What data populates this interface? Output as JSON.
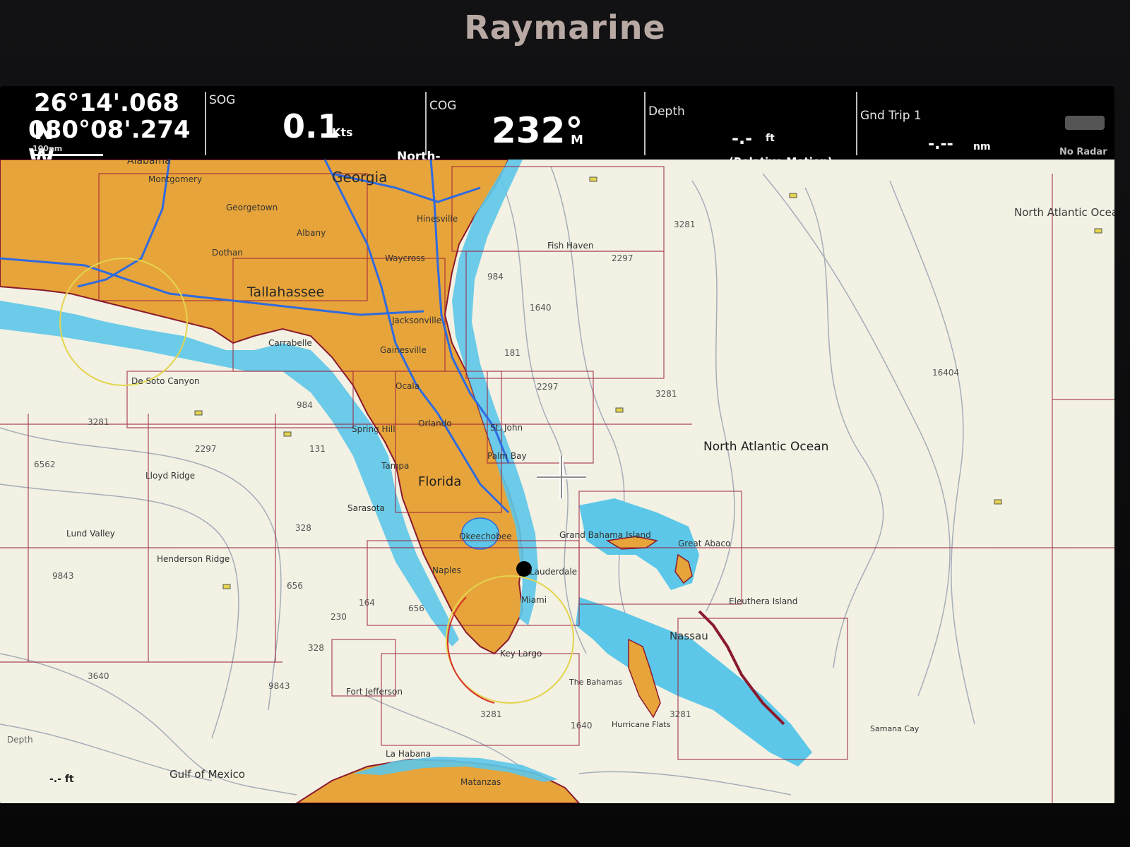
{
  "brand": "Raymarine",
  "colors": {
    "land": "#e7a43a",
    "shallow": "#5cc7e8",
    "sea": "#f2f1e4",
    "grid": "#9b1b3a",
    "route": "#2f6be0"
  },
  "databar": {
    "position": {
      "lat": "26°14'.068 N",
      "lon": "080°08'.274 W"
    },
    "sog": {
      "label": "SOG",
      "value": "0.1",
      "unit": "Kts"
    },
    "mode": "North-Up",
    "cog": {
      "label": "COG",
      "value": "232°",
      "unit": "M"
    },
    "depth": {
      "label": "Depth",
      "value": "-.-",
      "unit": "ft",
      "sub": "(Relative Motion)"
    },
    "trip": {
      "label": "Gnd Trip 1",
      "value": "-.--",
      "unit": "nm"
    },
    "radar": "No Radar"
  },
  "map": {
    "places": {
      "georgia": "Georgia",
      "tallahassee": "Tallahassee",
      "florida": "Florida",
      "jacksonville": "Jacksonville",
      "gainesville": "Gainesville",
      "ocala": "Ocala",
      "waycross": "Waycross",
      "albany": "Albany",
      "dothan": "Dothan",
      "georgetown": "Georgetown",
      "hinesville": "Hinesville",
      "fishhaven": "Fish Haven",
      "sarasota": "Sarasota",
      "naples": "Naples",
      "lauderdale": "Lauderdale",
      "miami": "Miami",
      "keylargo": "Key Largo",
      "okeechobee": "Okeechobee",
      "palmbay": "Palm Bay",
      "stjohn": "St. John",
      "orlando": "Orlando",
      "grandbahama": "Grand Bahama Island",
      "greatabaco": "Great Abaco",
      "eleuthera": "Eleuthera Island",
      "nassau": "Nassau",
      "fortjefferson": "Fort Jefferson",
      "nao1": "North Atlantic Ocean",
      "nao2": "North Atlantic Ocean",
      "desoto": "De Soto Canyon",
      "lloyd": "Lloyd Ridge",
      "henderson": "Henderson Ridge",
      "lund": "Lund Valley",
      "gulf": "Gulf of Mexico",
      "havana": "La Habana",
      "matanzas": "Matanzas",
      "samana": "Samana Cay",
      "carrabelle": "Carrabelle",
      "spring": "Spring Hill",
      "tampa": "Tampa",
      "alabama": "Alabama",
      "hurricane": "Hurricane Flats",
      "thebahamas": "The Bahamas",
      "montgomery": "Montgomery"
    },
    "soundings": [
      "3281",
      "2297",
      "1640",
      "984",
      "181",
      "2297",
      "3281",
      "16404",
      "2297",
      "131",
      "984",
      "6562",
      "3281",
      "328",
      "656",
      "164",
      "230",
      "328",
      "9843",
      "3640",
      "9843",
      "1640",
      "3281",
      "3281",
      "656"
    ],
    "scale": "100nm",
    "depth_corner": {
      "label": "Depth",
      "value": "-.- ft"
    }
  }
}
